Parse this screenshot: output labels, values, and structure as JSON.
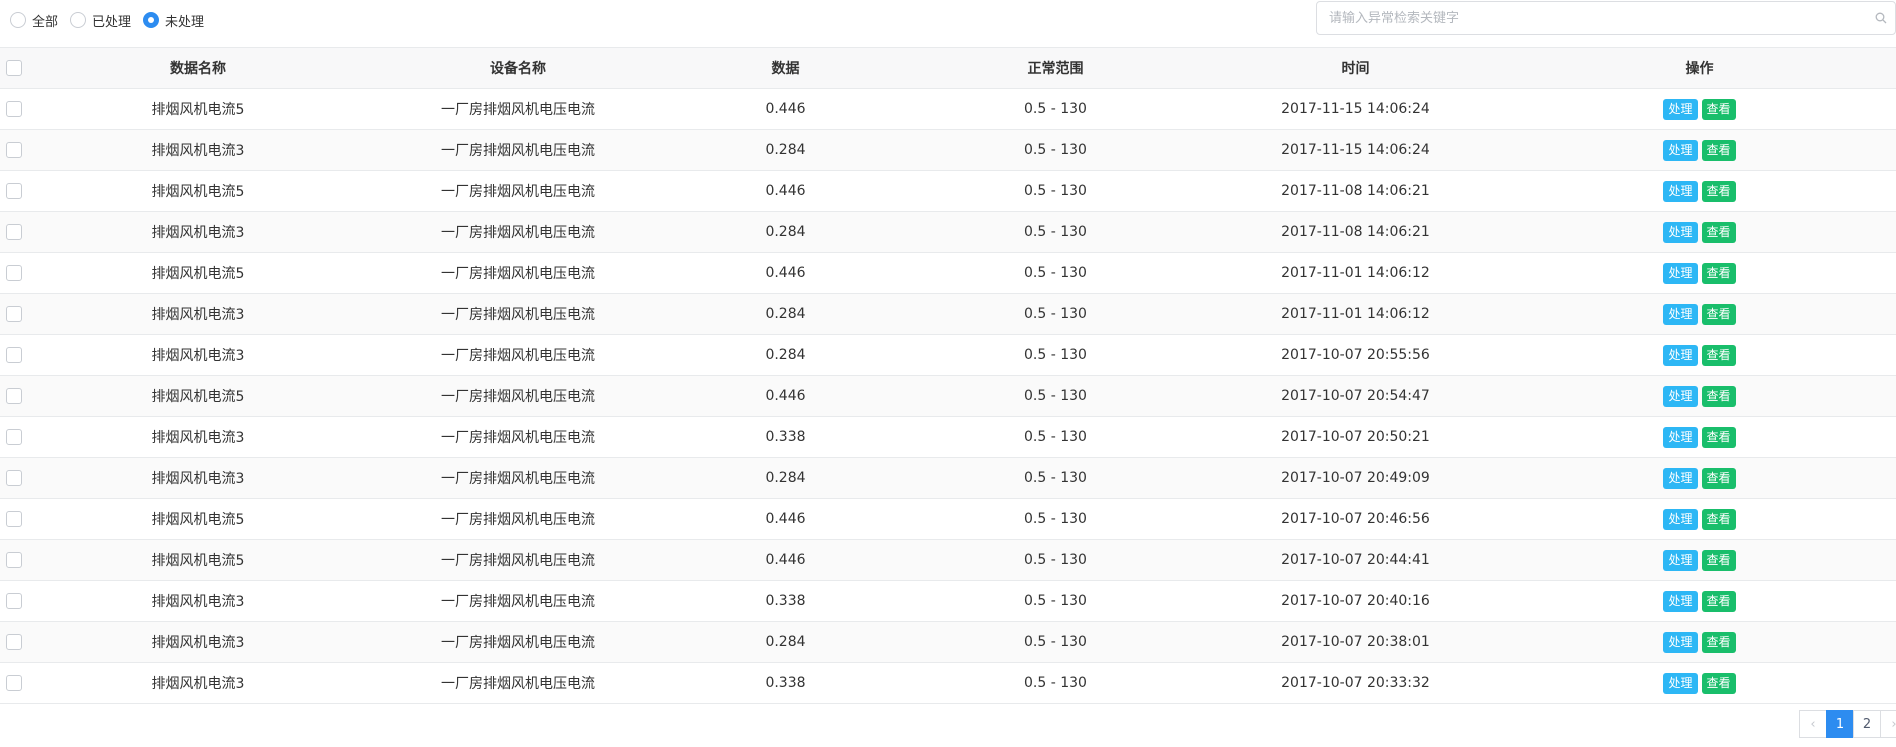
{
  "filter": {
    "options": [
      {
        "label": "全部",
        "selected": false
      },
      {
        "label": "已处理",
        "selected": false
      },
      {
        "label": "未处理",
        "selected": true
      }
    ]
  },
  "search": {
    "placeholder": "请输入异常检索关键字",
    "value": ""
  },
  "table": {
    "headers": [
      "数据名称",
      "设备名称",
      "数据",
      "正常范围",
      "时间",
      "操作"
    ],
    "action_labels": {
      "handle": "处理",
      "view": "查看"
    },
    "rows": [
      {
        "name": "排烟风机电流5",
        "device": "一厂房排烟风机电压电流",
        "value": "0.446",
        "range": "0.5 - 130",
        "time": "2017-11-15 14:06:24"
      },
      {
        "name": "排烟风机电流3",
        "device": "一厂房排烟风机电压电流",
        "value": "0.284",
        "range": "0.5 - 130",
        "time": "2017-11-15 14:06:24"
      },
      {
        "name": "排烟风机电流5",
        "device": "一厂房排烟风机电压电流",
        "value": "0.446",
        "range": "0.5 - 130",
        "time": "2017-11-08 14:06:21"
      },
      {
        "name": "排烟风机电流3",
        "device": "一厂房排烟风机电压电流",
        "value": "0.284",
        "range": "0.5 - 130",
        "time": "2017-11-08 14:06:21"
      },
      {
        "name": "排烟风机电流5",
        "device": "一厂房排烟风机电压电流",
        "value": "0.446",
        "range": "0.5 - 130",
        "time": "2017-11-01 14:06:12"
      },
      {
        "name": "排烟风机电流3",
        "device": "一厂房排烟风机电压电流",
        "value": "0.284",
        "range": "0.5 - 130",
        "time": "2017-11-01 14:06:12"
      },
      {
        "name": "排烟风机电流3",
        "device": "一厂房排烟风机电压电流",
        "value": "0.284",
        "range": "0.5 - 130",
        "time": "2017-10-07 20:55:56"
      },
      {
        "name": "排烟风机电流5",
        "device": "一厂房排烟风机电压电流",
        "value": "0.446",
        "range": "0.5 - 130",
        "time": "2017-10-07 20:54:47"
      },
      {
        "name": "排烟风机电流3",
        "device": "一厂房排烟风机电压电流",
        "value": "0.338",
        "range": "0.5 - 130",
        "time": "2017-10-07 20:50:21"
      },
      {
        "name": "排烟风机电流3",
        "device": "一厂房排烟风机电压电流",
        "value": "0.284",
        "range": "0.5 - 130",
        "time": "2017-10-07 20:49:09"
      },
      {
        "name": "排烟风机电流5",
        "device": "一厂房排烟风机电压电流",
        "value": "0.446",
        "range": "0.5 - 130",
        "time": "2017-10-07 20:46:56"
      },
      {
        "name": "排烟风机电流5",
        "device": "一厂房排烟风机电压电流",
        "value": "0.446",
        "range": "0.5 - 130",
        "time": "2017-10-07 20:44:41"
      },
      {
        "name": "排烟风机电流3",
        "device": "一厂房排烟风机电压电流",
        "value": "0.338",
        "range": "0.5 - 130",
        "time": "2017-10-07 20:40:16"
      },
      {
        "name": "排烟风机电流3",
        "device": "一厂房排烟风机电压电流",
        "value": "0.284",
        "range": "0.5 - 130",
        "time": "2017-10-07 20:38:01"
      },
      {
        "name": "排烟风机电流3",
        "device": "一厂房排烟风机电压电流",
        "value": "0.338",
        "range": "0.5 - 130",
        "time": "2017-10-07 20:33:32"
      }
    ]
  },
  "pagination": {
    "prev_icon": "chevron-left-icon",
    "pages": [
      "1",
      "2"
    ],
    "current": "1",
    "next_icon": "chevron-right-icon"
  },
  "colors": {
    "primary": "#2d8cf0",
    "handle_button": "#2db7f5",
    "view_button": "#19be6b"
  }
}
